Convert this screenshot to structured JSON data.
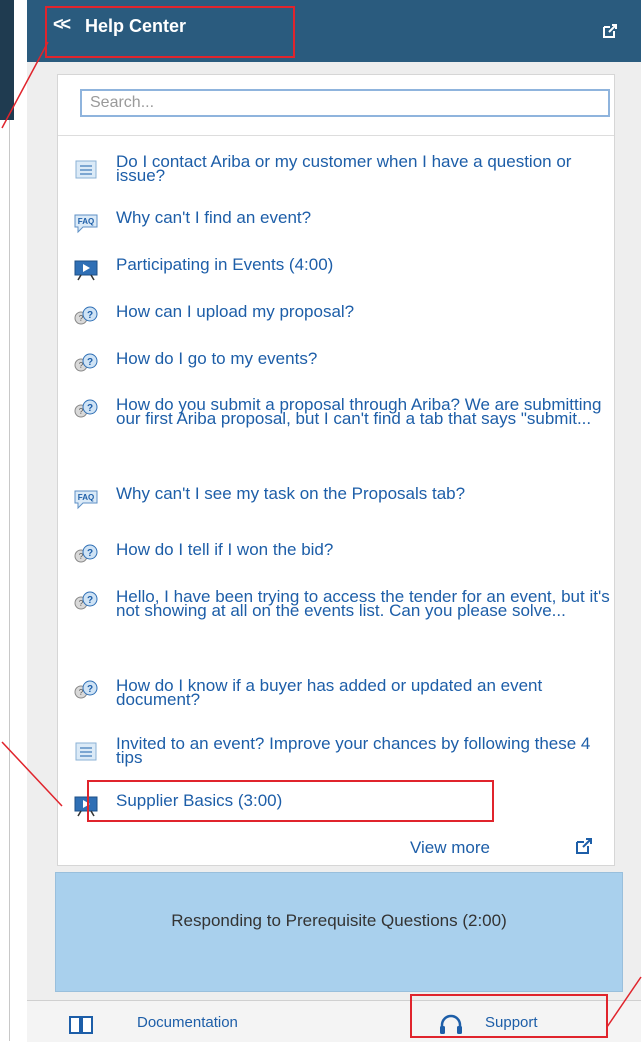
{
  "header": {
    "back_glyph": "<<",
    "title": "Help Center",
    "popout_icon": "external-link-icon"
  },
  "search": {
    "placeholder": "Search..."
  },
  "items": [
    {
      "icon": "document-icon",
      "text": "Do I contact Ariba or my customer when I have a question or issue?"
    },
    {
      "icon": "faq-icon",
      "text": "Why can't I find an event?"
    },
    {
      "icon": "video-icon",
      "text": "Participating in Events (4:00)"
    },
    {
      "icon": "question-people-icon",
      "text": "How can I upload my proposal?"
    },
    {
      "icon": "question-people-icon",
      "text": "How do I go to my events?"
    },
    {
      "icon": "question-people-icon",
      "text": "How do you submit a proposal through Ariba? We are submitting our first Ariba proposal, but I can't find a tab that says \"submit..."
    },
    {
      "icon": "faq-icon",
      "text": "Why can't I see my task on the Proposals tab?"
    },
    {
      "icon": "question-people-icon",
      "text": "How do I tell if I won the bid?"
    },
    {
      "icon": "question-people-icon",
      "text": "Hello, I have been trying to access the tender for an event, but it's not showing at all on the events list. Can you please solve..."
    },
    {
      "icon": "question-people-icon",
      "text": "How do I know if a buyer has added or updated an event document?"
    },
    {
      "icon": "document-icon",
      "text": "Invited to an event? Improve your chances by following these 4 tips"
    },
    {
      "icon": "video-icon",
      "text": "Supplier Basics (3:00)"
    }
  ],
  "view_more": {
    "label": "View more"
  },
  "featured_video": {
    "title": "Responding to Prerequisite Questions (2:00)"
  },
  "footer": {
    "documentation_label": "Documentation",
    "support_label": "Support"
  },
  "colors": {
    "header_bg": "#2a5b7e",
    "link": "#1d5ea8",
    "highlight": "#e0242c",
    "video_card": "#a9d0ed"
  }
}
